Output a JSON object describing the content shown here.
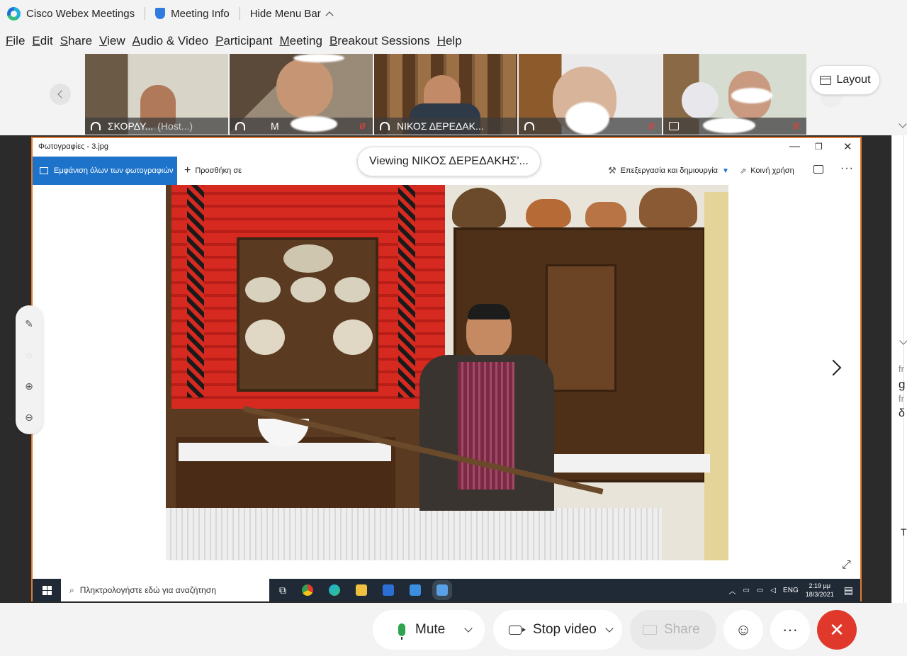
{
  "titlebar": {
    "app_name": "Cisco Webex Meetings",
    "meeting_info": "Meeting Info",
    "hide_menu": "Hide Menu Bar"
  },
  "menu": [
    "File",
    "Edit",
    "Share",
    "View",
    "Audio & Video",
    "Participant",
    "Meeting",
    "Breakout Sessions",
    "Help"
  ],
  "participants": [
    {
      "name": "ΣΚΟΡΔΥ...",
      "role": "(Host...)",
      "muted": false
    },
    {
      "name": "Μ",
      "role": "",
      "muted": true
    },
    {
      "name": "ΝΙΚΟΣ ΔΕΡΕΔΑΚ...",
      "role": "",
      "muted": false,
      "active": true
    },
    {
      "name": "",
      "role": "",
      "muted": true
    },
    {
      "name": "",
      "role": "",
      "muted": true
    }
  ],
  "layout_label": "Layout",
  "viewing_label": "Viewing ΝΙΚΟΣ ΔΕΡΕΔΑΚΗΣ'...",
  "photos_app": {
    "window_title": "Φωτογραφίες - 3.jpg",
    "show_all": "Εμφάνιση όλων των φωτογραφιών",
    "add_to": "Προσθήκη σε",
    "edit_create": "Επεξεργασία και δημιουργία",
    "share": "Κοινή χρήση"
  },
  "taskbar": {
    "search_placeholder": "Πληκτρολογήστε εδώ για αναζήτηση",
    "lang": "ENG",
    "time": "2:19 μμ",
    "date": "18/3/2021"
  },
  "right_panel_text": [
    "fr",
    "g",
    "fr",
    "δ",
    "T"
  ],
  "controls": {
    "mute": "Mute",
    "stop_video": "Stop video",
    "share": "Share"
  },
  "colors": {
    "accent_blue": "#2aa6e6",
    "share_border": "#e47a2f",
    "end_red": "#e0392b",
    "mic_green": "#2ea44f"
  }
}
